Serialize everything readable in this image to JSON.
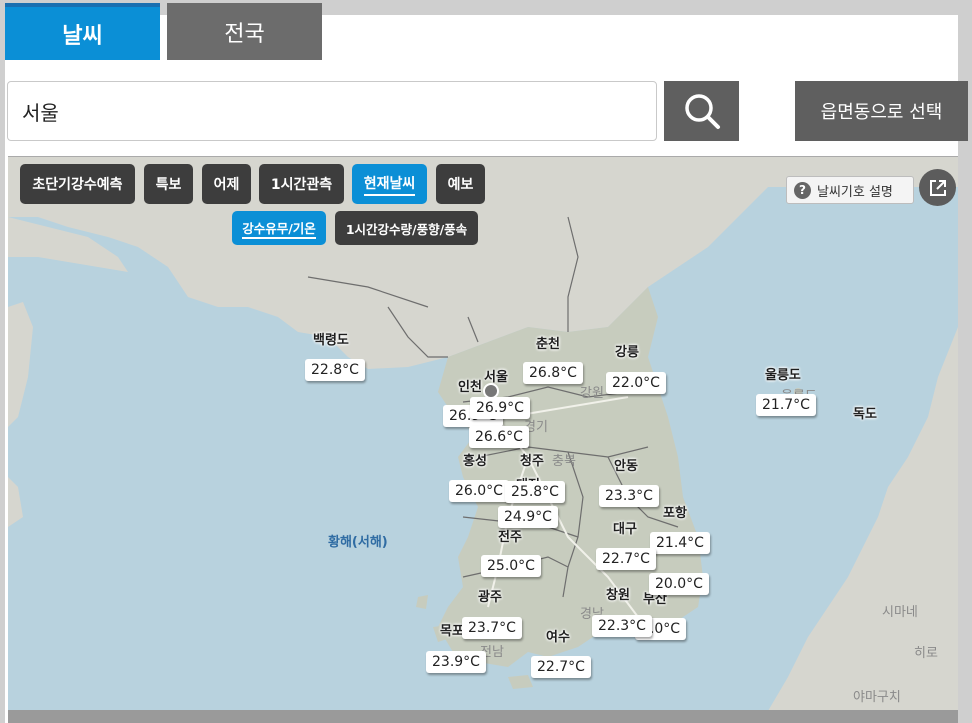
{
  "tabs": {
    "weather": "날씨",
    "national": "전국"
  },
  "search": {
    "value": "서울",
    "button_icon": "search-icon"
  },
  "region_button": "읍면동으로 선택",
  "map_tabs": [
    {
      "label": "초단기강수예측",
      "active": false
    },
    {
      "label": "특보",
      "active": false
    },
    {
      "label": "어제",
      "active": false
    },
    {
      "label": "1시간관측",
      "active": false
    },
    {
      "label": "현재날씨",
      "active": true
    },
    {
      "label": "예보",
      "active": false
    }
  ],
  "sub_tabs": [
    {
      "label": "강수유무/기온",
      "active": true
    },
    {
      "label": "1시간강수량/풍향/풍속",
      "active": false
    }
  ],
  "help_button": "날씨기호 설명",
  "external_icon": "external-link-icon",
  "places": {
    "baengnyeong": "백령도",
    "chuncheon": "춘천",
    "gangneung": "강릉",
    "ulleung": "울릉도",
    "ulleung_faint": "울릉도",
    "dokdo": "독도",
    "seoul": "서울",
    "incheon": "인천",
    "gyeonggi": "경기",
    "gangwon": "강원",
    "hongseong": "홍성",
    "cheongju": "청주",
    "chungbuk": "충북",
    "daejeon": "대전",
    "andong": "안동",
    "pohang": "포항",
    "daegu": "대구",
    "jeonju": "전주",
    "gwangju": "광주",
    "changwon": "창원",
    "busan": "부산",
    "gyeongnam": "경남",
    "mokpo": "목포",
    "jeonnam": "전남",
    "yeosu": "여수",
    "hwanghae": "황해(서해)",
    "shimane": "시마네",
    "hiroshima": "히로",
    "yamaguchi": "야마구치"
  },
  "temps": {
    "baengnyeong": "22.8°C",
    "chuncheon": "26.8°C",
    "gangneung": "22.0°C",
    "ulleung": "21.7°C",
    "incheon": "26.9°C",
    "seoul": "26.9°C",
    "suwon": "26.6°C",
    "hongseong": "26.0°C",
    "cheongju": "25.8°C",
    "andong": "23.3°C",
    "daejeon": "24.9°C",
    "pohang": "21.4°C",
    "daegu": "22.7°C",
    "jeonju": "25.0°C",
    "ulsan": "20.0°C",
    "changwon": "22.3°C",
    "busan": "0.0°C",
    "mokpo": "23.7°C",
    "heuksando": "23.9°C",
    "yeosu": "22.7°C"
  }
}
